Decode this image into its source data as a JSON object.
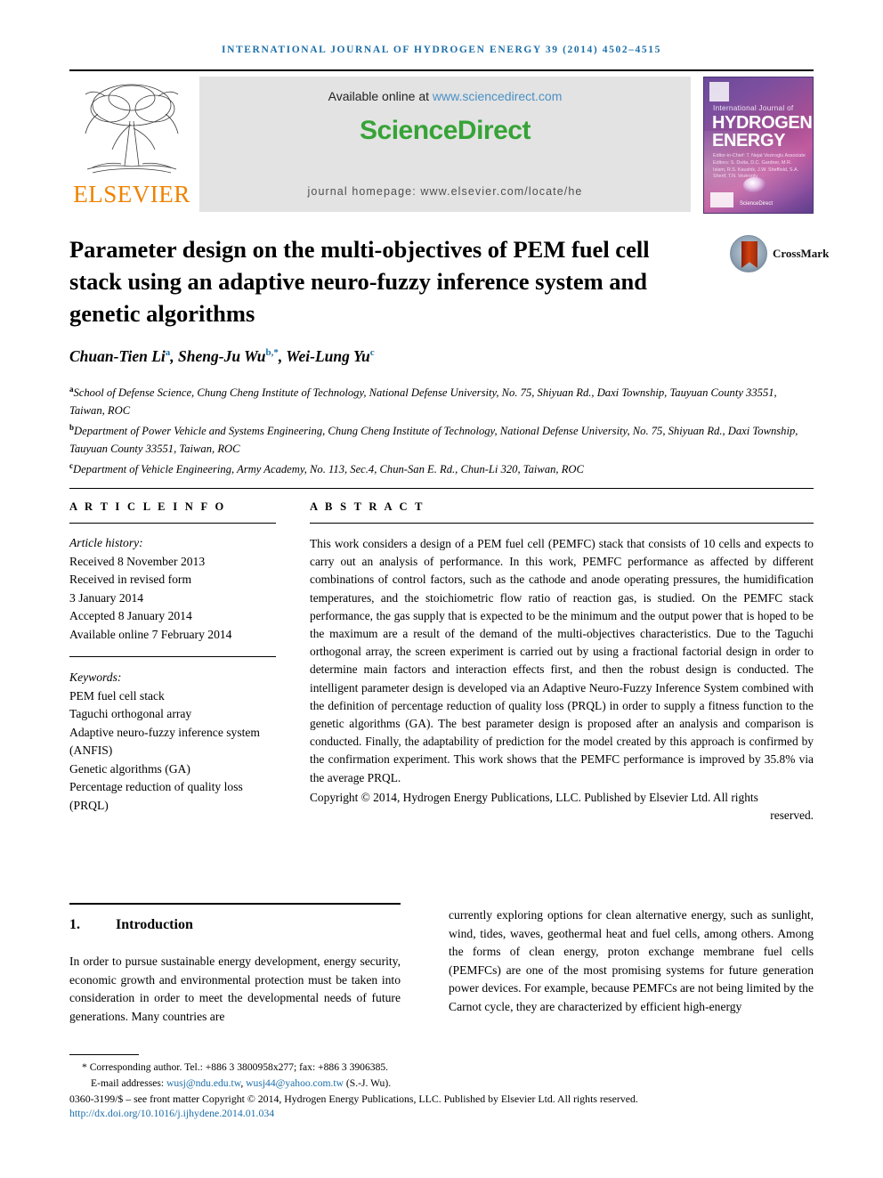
{
  "running_head": "INTERNATIONAL JOURNAL OF HYDROGEN ENERGY 39 (2014) 4502–4515",
  "masthead": {
    "available_prefix": "Available online at ",
    "sciencedirect_url": "www.sciencedirect.com",
    "sciencedirect_logo": "ScienceDirect",
    "homepage_line": "journal homepage: www.elsevier.com/locate/he",
    "publisher_name": "ELSEVIER",
    "cover": {
      "smallcaps": "International Journal of",
      "title_line1": "HYDROGEN",
      "title_line2": "ENERGY",
      "editors": "Editor-in-Chief: T. Nejat Veziroglu   Associate Editors: S. Dutta, D.C. Gardner, M.R. Islam, R.S. Kaushik, J.W. Sheffield, S.A. Sherif, T.N. Veziroglu",
      "sciencedirect_mark": "ScienceDirect"
    }
  },
  "article": {
    "title": "Parameter design on the multi-objectives of PEM fuel cell stack using an adaptive neuro-fuzzy inference system and genetic algorithms",
    "crossmark_label": "CrossMark",
    "authors": [
      {
        "name": "Chuan-Tien Li",
        "sup": "a"
      },
      {
        "name": "Sheng-Ju Wu",
        "sup": "b,*"
      },
      {
        "name": "Wei-Lung Yu",
        "sup": "c"
      }
    ],
    "affiliations": [
      {
        "sup": "a",
        "text": "School of Defense Science, Chung Cheng Institute of Technology, National Defense University, No. 75, Shiyuan Rd., Daxi Township, Tauyuan County 33551, Taiwan, ROC"
      },
      {
        "sup": "b",
        "text": "Department of Power Vehicle and Systems Engineering, Chung Cheng Institute of Technology, National Defense University, No. 75, Shiyuan Rd., Daxi Township, Tauyuan County 33551, Taiwan, ROC"
      },
      {
        "sup": "c",
        "text": "Department of Vehicle Engineering, Army Academy, No. 113, Sec.4, Chun-San E. Rd., Chun-Li 320, Taiwan, ROC"
      }
    ]
  },
  "article_info": {
    "label": "A R T I C L E   I N F O",
    "history_label": "Article history:",
    "history": [
      "Received 8 November 2013",
      "Received in revised form",
      "3 January 2014",
      "Accepted 8 January 2014",
      "Available online 7 February 2014"
    ],
    "keywords_label": "Keywords:",
    "keywords": [
      "PEM fuel cell stack",
      "Taguchi orthogonal array",
      "Adaptive neuro-fuzzy inference system (ANFIS)",
      "Genetic algorithms (GA)",
      "Percentage reduction of quality loss (PRQL)"
    ]
  },
  "abstract": {
    "label": "A B S T R A C T",
    "body": "This work considers a design of a PEM fuel cell (PEMFC) stack that consists of 10 cells and expects to carry out an analysis of performance. In this work, PEMFC performance as affected by different combinations of control factors, such as the cathode and anode operating pressures, the humidification temperatures, and the stoichiometric flow ratio of reaction gas, is studied. On the PEMFC stack performance, the gas supply that is expected to be the minimum and the output power that is hoped to be the maximum are a result of the demand of the multi-objectives characteristics. Due to the Taguchi orthogonal array, the screen experiment is carried out by using a fractional factorial design in order to determine main factors and interaction effects first, and then the robust design is conducted. The intelligent parameter design is developed via an Adaptive Neuro-Fuzzy Inference System combined with the definition of percentage reduction of quality loss (PRQL) in order to supply a fitness function to the genetic algorithms (GA). The best parameter design is proposed after an analysis and comparison is conducted. Finally, the adaptability of prediction for the model created by this approach is confirmed by the confirmation experiment. This work shows that the PEMFC performance is improved by 35.8% via the average PRQL.",
    "copyright": "Copyright © 2014, Hydrogen Energy Publications, LLC. Published by Elsevier Ltd. All rights",
    "copyright_last": "reserved."
  },
  "introduction": {
    "number": "1.",
    "heading": "Introduction",
    "left_column": "In order to pursue sustainable energy development, energy security, economic growth and environmental protection must be taken into consideration in order to meet the developmental needs of future generations. Many countries are",
    "right_column": "currently exploring options for clean alternative energy, such as sunlight, wind, tides, waves, geothermal heat and fuel cells, among others. Among the forms of clean energy, proton exchange membrane fuel cells (PEMFCs) are one of the most promising systems for future generation power devices. For example, because PEMFCs are not being limited by the Carnot cycle, they are characterized by efficient high-energy"
  },
  "footer": {
    "corresponding": "* Corresponding author. Tel.: +886 3 3800958x277; fax: +886 3 3906385.",
    "email_label": "E-mail addresses: ",
    "email1": "wusj@ndu.edu.tw",
    "email_sep": ", ",
    "email2": "wusj44@yahoo.com.tw",
    "email_suffix": " (S.-J. Wu).",
    "front_matter": "0360-3199/$ – see front matter Copyright © 2014, Hydrogen Energy Publications, LLC. Published by Elsevier Ltd. All rights reserved.",
    "doi": "http://dx.doi.org/10.1016/j.ijhydene.2014.01.034"
  },
  "colors": {
    "running_head": "#1b6ea8",
    "elsevier_orange": "#ef8200",
    "sciencedirect_green": "#36a336",
    "link_blue": "#1b6ea8"
  }
}
